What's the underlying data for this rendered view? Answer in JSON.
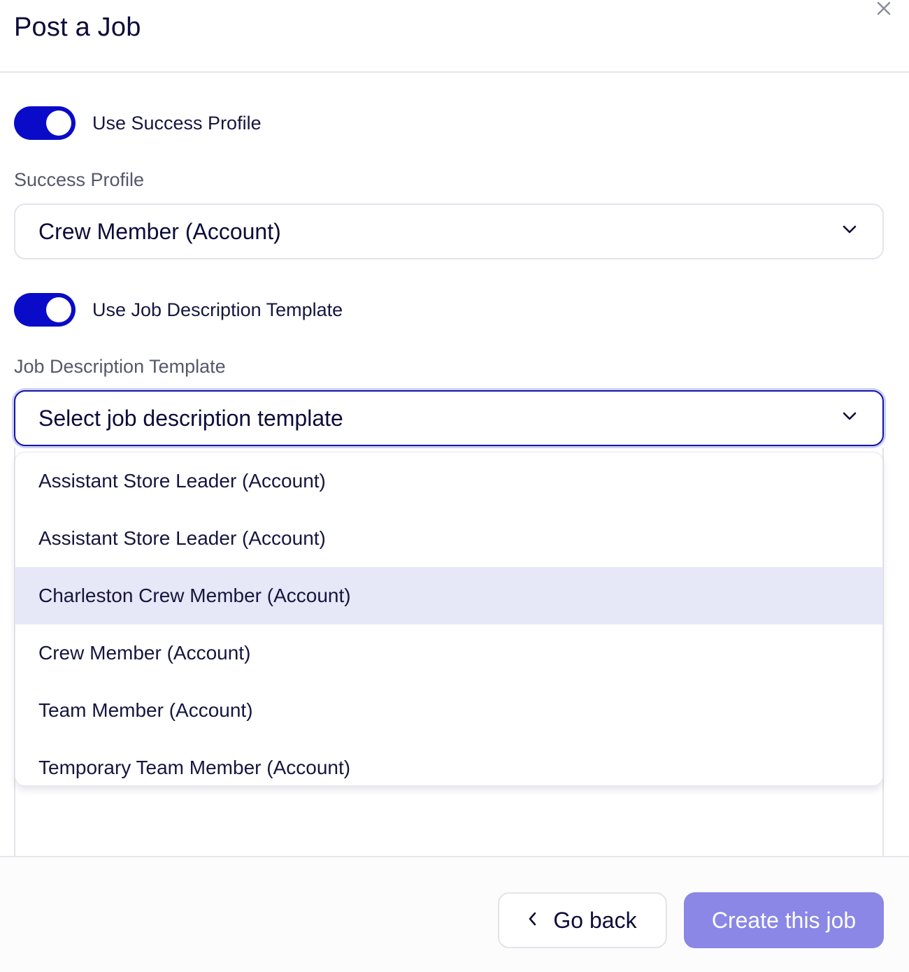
{
  "header": {
    "title": "Post a Job",
    "close_icon": "close-icon"
  },
  "success_profile_toggle": {
    "label": "Use Success Profile",
    "on": true
  },
  "success_profile": {
    "label": "Success Profile",
    "value": "Crew Member (Account)"
  },
  "template_toggle": {
    "label": "Use Job Description Template",
    "on": true
  },
  "template": {
    "label": "Job Description Template",
    "placeholder": "Select job description template",
    "options": [
      "Assistant Store Leader (Account)",
      "Assistant Store Leader (Account)",
      "Charleston Crew Member (Account)",
      "Crew Member (Account)",
      "Team Member (Account)",
      "Temporary Team Member (Account)"
    ],
    "highlighted_option": "Charleston Crew Member (Account)"
  },
  "footer": {
    "back_label": "Go back",
    "create_label": "Create this job"
  },
  "colors": {
    "toggle_on": "#0a0bc8",
    "primary_button": "#8a87e6",
    "option_highlight": "#e6e8f7",
    "focus_border": "#1414a6"
  }
}
